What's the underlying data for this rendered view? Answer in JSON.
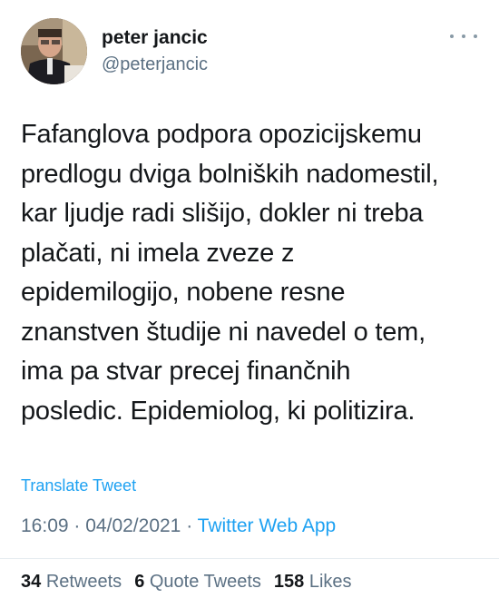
{
  "author": {
    "display_name": "peter jancic",
    "handle": "@peterjancic"
  },
  "tweet": {
    "text": "Fafanglova podpora opozicijskemu\npredlogu dviga bolniških nadomestil,\nkar ljudje radi slišijo, dokler ni treba\nplačati, ni imela zveze z\nepidemilogijo, nobene resne\nznanstven študije ni navedel o tem,\nima pa stvar precej finančnih\nposledic. Epidemiolog, ki politizira.",
    "translate_label": "Translate Tweet",
    "time": "16:09",
    "separator": "·",
    "date": "04/02/2021",
    "source": "Twitter Web App"
  },
  "stats": {
    "retweets_count": "34",
    "retweets_label": "Retweets",
    "quote_tweets_count": "6",
    "quote_tweets_label": "Quote Tweets",
    "likes_count": "158",
    "likes_label": "Likes"
  },
  "icons": {
    "more": "more-horizontal-icon"
  },
  "colors": {
    "link": "#1da1f2",
    "secondary_text": "#5b7083",
    "primary_text": "#14171a"
  }
}
